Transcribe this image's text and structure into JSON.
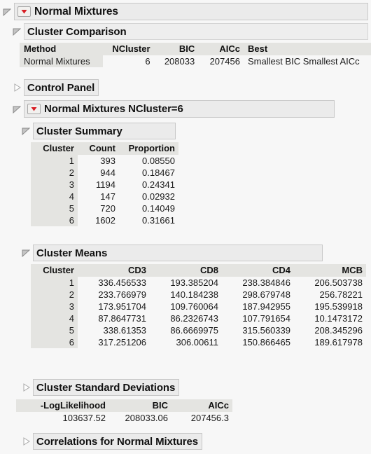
{
  "report": {
    "title": "Normal Mixtures",
    "sections": {
      "cluster_comparison": "Cluster Comparison",
      "control_panel": "Control Panel",
      "normal_mixtures_ncluster": "Normal Mixtures NCluster=6",
      "cluster_summary": "Cluster Summary",
      "cluster_means": "Cluster Means",
      "cluster_std_dev": "Cluster Standard Deviations",
      "correlations": "Correlations for Normal Mixtures"
    },
    "icons": {
      "popup_red": "red-triangle-popup-icon",
      "open": "disclosure-open-icon",
      "closed": "disclosure-closed-icon"
    },
    "colors": {
      "popup_red": "#d81f26",
      "header_bg": "#e4e4e1",
      "bar_bg": "#ebebeb",
      "page_bg": "#f7f7f7"
    }
  },
  "cluster_comparison": {
    "columns": [
      "Method",
      "NCluster",
      "BIC",
      "AICc",
      "Best"
    ],
    "rows": [
      {
        "method": "Normal Mixtures",
        "ncluster": "6",
        "bic": "208033",
        "aicc": "207456",
        "best": "Smallest BIC Smallest AICc"
      }
    ]
  },
  "cluster_summary": {
    "columns": [
      "Cluster",
      "Count",
      "Proportion"
    ],
    "rows": [
      {
        "cluster": "1",
        "count": "393",
        "proportion": "0.08550"
      },
      {
        "cluster": "2",
        "count": "944",
        "proportion": "0.18467"
      },
      {
        "cluster": "3",
        "count": "1194",
        "proportion": "0.24341"
      },
      {
        "cluster": "4",
        "count": "147",
        "proportion": "0.02932"
      },
      {
        "cluster": "5",
        "count": "720",
        "proportion": "0.14049"
      },
      {
        "cluster": "6",
        "count": "1602",
        "proportion": "0.31661"
      }
    ]
  },
  "cluster_means": {
    "columns": [
      "Cluster",
      "CD3",
      "CD8",
      "CD4",
      "MCB"
    ],
    "rows": [
      {
        "cluster": "1",
        "cd3": "336.456533",
        "cd8": "193.385204",
        "cd4": "238.384846",
        "mcb": "206.503738"
      },
      {
        "cluster": "2",
        "cd3": "233.766979",
        "cd8": "140.184238",
        "cd4": "298.679748",
        "mcb": "256.78221"
      },
      {
        "cluster": "3",
        "cd3": "173.951704",
        "cd8": "109.760064",
        "cd4": "187.942955",
        "mcb": "195.539918"
      },
      {
        "cluster": "4",
        "cd3": "87.8647731",
        "cd8": "86.2326743",
        "cd4": "107.791654",
        "mcb": "10.1473172"
      },
      {
        "cluster": "5",
        "cd3": "338.61353",
        "cd8": "86.6669975",
        "cd4": "315.560339",
        "mcb": "208.345296"
      },
      {
        "cluster": "6",
        "cd3": "317.251206",
        "cd8": "306.00611",
        "cd4": "150.866465",
        "mcb": "189.617978"
      }
    ]
  },
  "fit_statistics": {
    "columns": [
      "-LogLikelihood",
      "BIC",
      "AICc"
    ],
    "rows": [
      {
        "loglikelihood": "103637.52",
        "bic": "208033.06",
        "aicc": "207456.3"
      }
    ]
  }
}
